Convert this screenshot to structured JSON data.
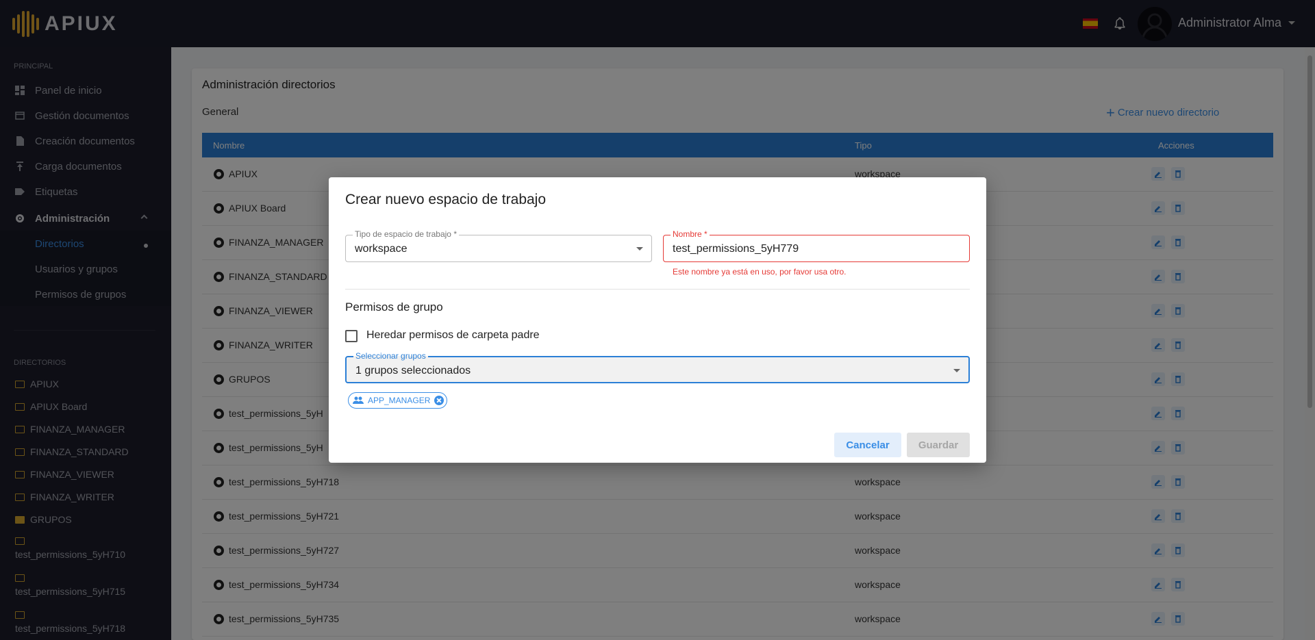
{
  "app": {
    "logo_text": "APIUX",
    "user_name": "Administrator Alma"
  },
  "sidebar": {
    "section_principal": "PRINCIPAL",
    "items": [
      {
        "label": "Panel de inicio",
        "icon": "dashboard-icon"
      },
      {
        "label": "Gestión documentos",
        "icon": "folder-open-icon"
      },
      {
        "label": "Creación documentos",
        "icon": "file-icon"
      },
      {
        "label": "Carga documentos",
        "icon": "upload-icon"
      },
      {
        "label": "Etiquetas",
        "icon": "label-icon"
      }
    ],
    "admin_label": "Administración",
    "admin_sub": [
      {
        "label": "Directorios",
        "current": true
      },
      {
        "label": "Usuarios y grupos"
      },
      {
        "label": "Permisos de grupos"
      }
    ],
    "section_directorios": "DIRECTORIOS",
    "directories": [
      "APIUX",
      "APIUX Board",
      "FINANZA_MANAGER",
      "FINANZA_STANDARD",
      "FINANZA_VIEWER",
      "FINANZA_WRITER",
      "GRUPOS"
    ],
    "directories_long": [
      "test_permissions_5yH710",
      "test_permissions_5yH715",
      "test_permissions_5yH718"
    ]
  },
  "main": {
    "title": "Administración directorios",
    "subtitle": "General",
    "create_label": "Crear nuevo directorio",
    "columns": [
      "Nombre",
      "Tipo",
      "Acciones"
    ],
    "rows": [
      {
        "name": "APIUX",
        "type": "workspace"
      },
      {
        "name": "APIUX Board",
        "type": ""
      },
      {
        "name": "FINANZA_MANAGER",
        "type": ""
      },
      {
        "name": "FINANZA_STANDARD",
        "type": ""
      },
      {
        "name": "FINANZA_VIEWER",
        "type": ""
      },
      {
        "name": "FINANZA_WRITER",
        "type": ""
      },
      {
        "name": "GRUPOS",
        "type": ""
      },
      {
        "name": "test_permissions_5yH",
        "type": ""
      },
      {
        "name": "test_permissions_5yH",
        "type": ""
      },
      {
        "name": "test_permissions_5yH718",
        "type": "workspace"
      },
      {
        "name": "test_permissions_5yH721",
        "type": "workspace"
      },
      {
        "name": "test_permissions_5yH727",
        "type": "workspace"
      },
      {
        "name": "test_permissions_5yH734",
        "type": "workspace"
      },
      {
        "name": "test_permissions_5yH735",
        "type": "workspace"
      }
    ]
  },
  "dialog": {
    "title": "Crear nuevo espacio de trabajo",
    "type_label": "Tipo de espacio de trabajo *",
    "type_value": "workspace",
    "name_label": "Nombre *",
    "name_value": "test_permissions_5yH779",
    "name_error": "Este nombre ya está en uso, por favor usa otro.",
    "section_title": "Permisos de grupo",
    "inherit_label": "Heredar permisos de carpeta padre",
    "inherit_checked": false,
    "groups_label": "Seleccionar grupos",
    "groups_value": "1 grupos seleccionados",
    "chips": [
      "APP_MANAGER"
    ],
    "cancel_label": "Cancelar",
    "save_label": "Guardar"
  },
  "colors": {
    "accent": "#2b7fd6",
    "error": "#e53935",
    "sidebar_bg": "#1c1d2b",
    "topbar_bg": "#1b1c2b",
    "logo_gold": "#e0a82e"
  }
}
